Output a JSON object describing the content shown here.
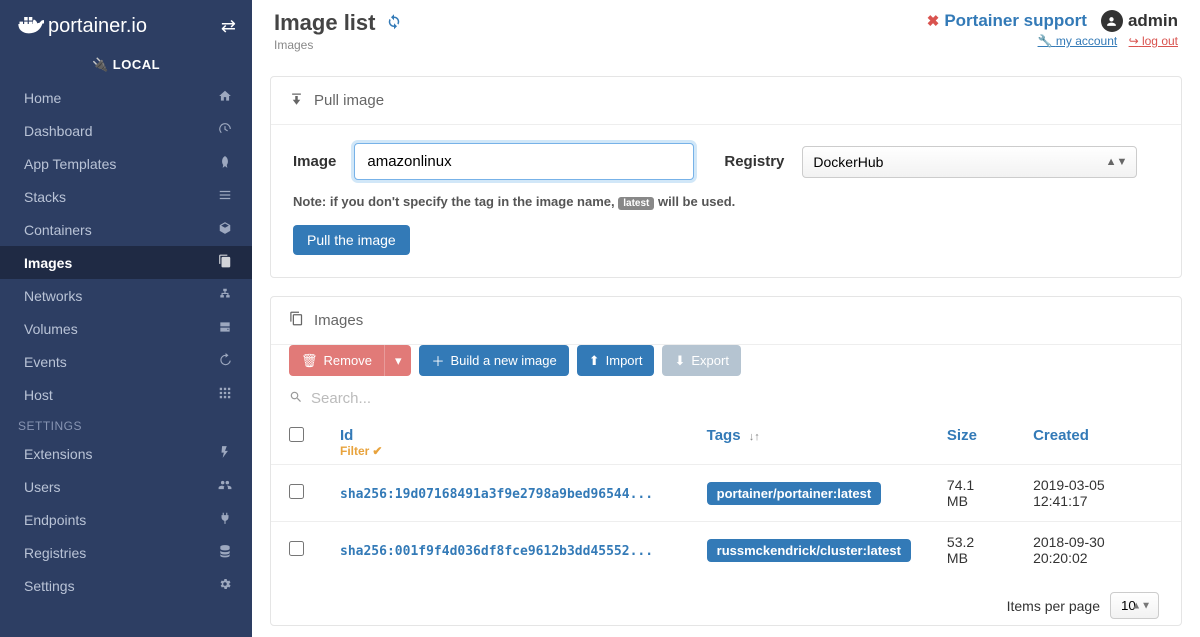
{
  "brand": "portainer.io",
  "env_label": "LOCAL",
  "nav_items": [
    {
      "label": "Home",
      "icon": "home"
    },
    {
      "label": "Dashboard",
      "icon": "dash"
    },
    {
      "label": "App Templates",
      "icon": "rocket"
    },
    {
      "label": "Stacks",
      "icon": "list"
    },
    {
      "label": "Containers",
      "icon": "cube"
    },
    {
      "label": "Images",
      "icon": "clone",
      "active": true
    },
    {
      "label": "Networks",
      "icon": "sitemap"
    },
    {
      "label": "Volumes",
      "icon": "hdd"
    },
    {
      "label": "Events",
      "icon": "history"
    },
    {
      "label": "Host",
      "icon": "grid"
    }
  ],
  "settings_heading": "SETTINGS",
  "settings_items": [
    {
      "label": "Extensions",
      "icon": "bolt"
    },
    {
      "label": "Users",
      "icon": "users"
    },
    {
      "label": "Endpoints",
      "icon": "plug"
    },
    {
      "label": "Registries",
      "icon": "db"
    },
    {
      "label": "Settings",
      "icon": "cogs"
    }
  ],
  "header": {
    "title": "Image list",
    "breadcrumb": "Images",
    "support": "Portainer support",
    "username": "admin",
    "my_account": "my account",
    "logout": "log out"
  },
  "pull": {
    "panel_title": "Pull image",
    "image_label": "Image",
    "image_value": "amazonlinux",
    "registry_label": "Registry",
    "registry_value": "DockerHub",
    "note_pre": "Note: if you don't specify the tag in the image name, ",
    "note_chip": "latest",
    "note_post": " will be used.",
    "button": "Pull the image"
  },
  "images_panel": {
    "title": "Images",
    "remove": "Remove",
    "build": "Build a new image",
    "import": "Import",
    "export": "Export",
    "search_placeholder": "Search...",
    "col_id": "Id",
    "filter": "Filter",
    "col_tags": "Tags",
    "col_size": "Size",
    "col_created": "Created",
    "rows": [
      {
        "id": "sha256:19d07168491a3f9e2798a9bed96544...",
        "tag": "portainer/portainer:latest",
        "size": "74.1 MB",
        "created": "2019-03-05 12:41:17"
      },
      {
        "id": "sha256:001f9f4d036df8fce9612b3dd45552...",
        "tag": "russmckendrick/cluster:latest",
        "size": "53.2 MB",
        "created": "2018-09-30 20:20:02"
      }
    ],
    "items_per_page": "Items per page",
    "per_page_value": "10"
  }
}
